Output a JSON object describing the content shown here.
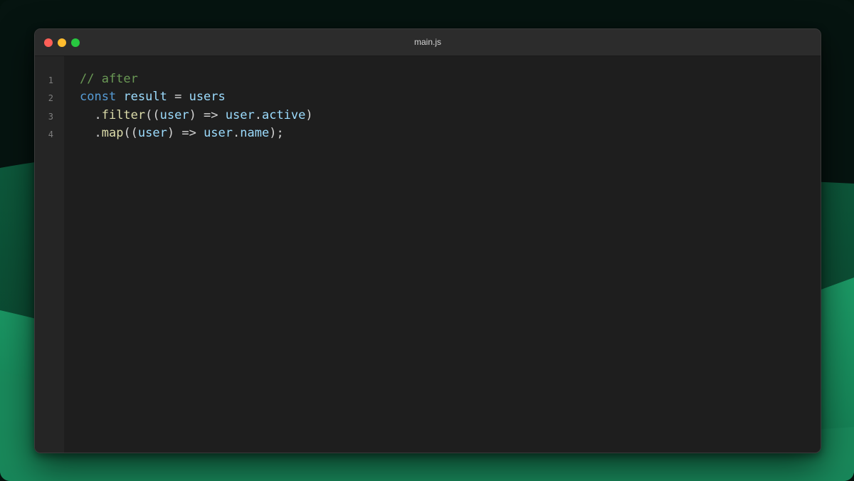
{
  "window": {
    "title": "main.js"
  },
  "editor": {
    "line_numbers": [
      "1",
      "2",
      "3",
      "4"
    ],
    "lines": [
      [
        {
          "t": "// after",
          "k": "comment"
        }
      ],
      [
        {
          "t": "const",
          "k": "keyword"
        },
        {
          "t": " ",
          "k": "plain"
        },
        {
          "t": "result",
          "k": "var"
        },
        {
          "t": " = ",
          "k": "plain"
        },
        {
          "t": "users",
          "k": "var"
        }
      ],
      [
        {
          "t": "  .",
          "k": "plain"
        },
        {
          "t": "filter",
          "k": "func"
        },
        {
          "t": "((",
          "k": "plain"
        },
        {
          "t": "user",
          "k": "var"
        },
        {
          "t": ") => ",
          "k": "plain"
        },
        {
          "t": "user",
          "k": "var"
        },
        {
          "t": ".",
          "k": "plain"
        },
        {
          "t": "active",
          "k": "var"
        },
        {
          "t": ")",
          "k": "plain"
        }
      ],
      [
        {
          "t": "  .",
          "k": "plain"
        },
        {
          "t": "map",
          "k": "func"
        },
        {
          "t": "((",
          "k": "plain"
        },
        {
          "t": "user",
          "k": "var"
        },
        {
          "t": ") => ",
          "k": "plain"
        },
        {
          "t": "user",
          "k": "var"
        },
        {
          "t": ".",
          "k": "plain"
        },
        {
          "t": "name",
          "k": "var"
        },
        {
          "t": ");",
          "k": "plain"
        }
      ]
    ]
  },
  "colors": {
    "window_bg": "#1e1e1e",
    "titlebar_bg": "#2c2c2c",
    "close_dot": "#ff5f57",
    "minimize_dot": "#febc2e",
    "maximize_dot": "#28c840",
    "comment": "#6a9955",
    "keyword": "#569cd6",
    "variable": "#9cdcfe",
    "function": "#dcdcaa",
    "background_green": "#1a8a5c"
  }
}
